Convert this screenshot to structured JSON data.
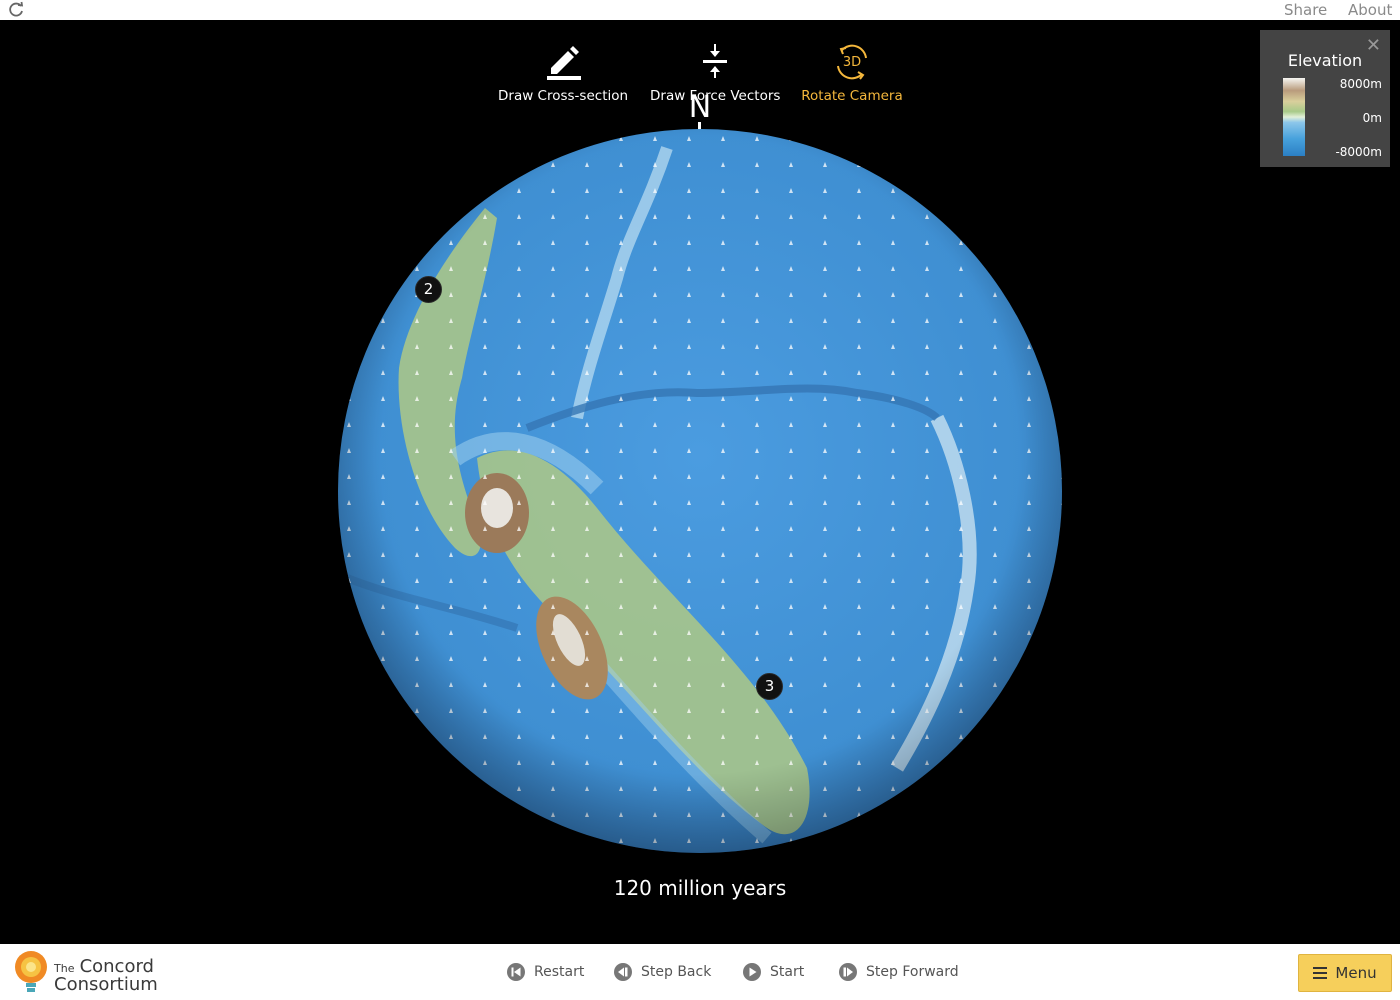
{
  "topbar": {
    "share_label": "Share",
    "about_label": "About",
    "reload_icon": "reload-icon"
  },
  "toolbar": {
    "cross_section_label": "Draw Cross-section",
    "force_vectors_label": "Draw Force Vectors",
    "rotate_camera_label": "Rotate Camera",
    "rotate_camera_icon_text": "3D",
    "active_tool": "Rotate Camera",
    "active_color": "#f4b73c"
  },
  "globe": {
    "north_label": "N",
    "plate_markers": [
      "2",
      "3"
    ],
    "time_label": "120 million years"
  },
  "legend": {
    "title": "Elevation",
    "max_label": "8000m",
    "mid_label": "0m",
    "min_label": "-8000m",
    "close_icon": "close-icon"
  },
  "footer": {
    "logo_the": "The",
    "logo_line1": "Concord",
    "logo_line2": "Consortium",
    "restart_label": "Restart",
    "step_back_label": "Step Back",
    "start_label": "Start",
    "step_forward_label": "Step Forward",
    "menu_label": "Menu",
    "menu_color": "#f6cf5b"
  },
  "colors": {
    "ocean": "#3f8fd2",
    "land": "#a9c58a",
    "mountain": "#9b7a5a"
  }
}
